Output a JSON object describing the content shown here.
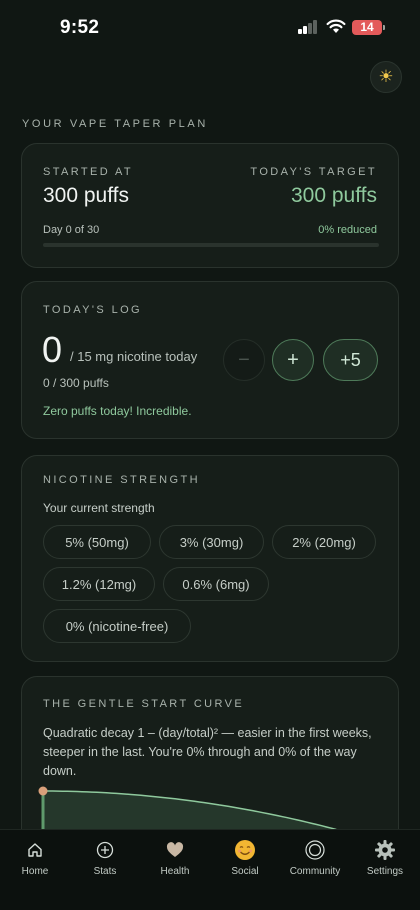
{
  "status_bar": {
    "time": "9:52",
    "battery": "14"
  },
  "section_title": "YOUR VAPE TAPER PLAN",
  "plan": {
    "started_label": "STARTED AT",
    "started_value": "300 puffs",
    "target_label": "TODAY'S TARGET",
    "target_value": "300 puffs",
    "day_text": "Day 0 of 30",
    "reduced_text": "0% reduced",
    "progress_fraction": 0
  },
  "log": {
    "label": "TODAY'S LOG",
    "count": "0",
    "nicotine_text": "/ 15 mg nicotine today",
    "puffs_text": "0 / 300 puffs",
    "message": "Zero puffs today! Incredible.",
    "minus_label": "−",
    "plus_label": "+",
    "plus5_label": "+5"
  },
  "strength": {
    "label": "NICOTINE STRENGTH",
    "subtitle": "Your current strength",
    "options": [
      "5% (50mg)",
      "3% (30mg)",
      "2% (20mg)",
      "1.2% (12mg)",
      "0.6% (6mg)",
      "0% (nicotine-free)"
    ],
    "selected": "5% (50mg)"
  },
  "curve": {
    "label": "THE GENTLE START CURVE",
    "description": "Quadratic decay 1 – (day/total)² — easier in the first weeks, steeper in the last. You're 0% through and 0% of the way down.",
    "progress_fraction": 0
  },
  "nav": [
    {
      "label": "Home",
      "icon": "home-icon"
    },
    {
      "label": "Stats",
      "icon": "plus-circle-icon"
    },
    {
      "label": "Health",
      "icon": "heart-icon"
    },
    {
      "label": "Social",
      "icon": "smiling-face-icon"
    },
    {
      "label": "Community",
      "icon": "rings-icon"
    },
    {
      "label": "Settings",
      "icon": "gear-icon"
    }
  ],
  "colors": {
    "accent": "#8fc99d",
    "background": "#101713",
    "card": "#161e19"
  }
}
